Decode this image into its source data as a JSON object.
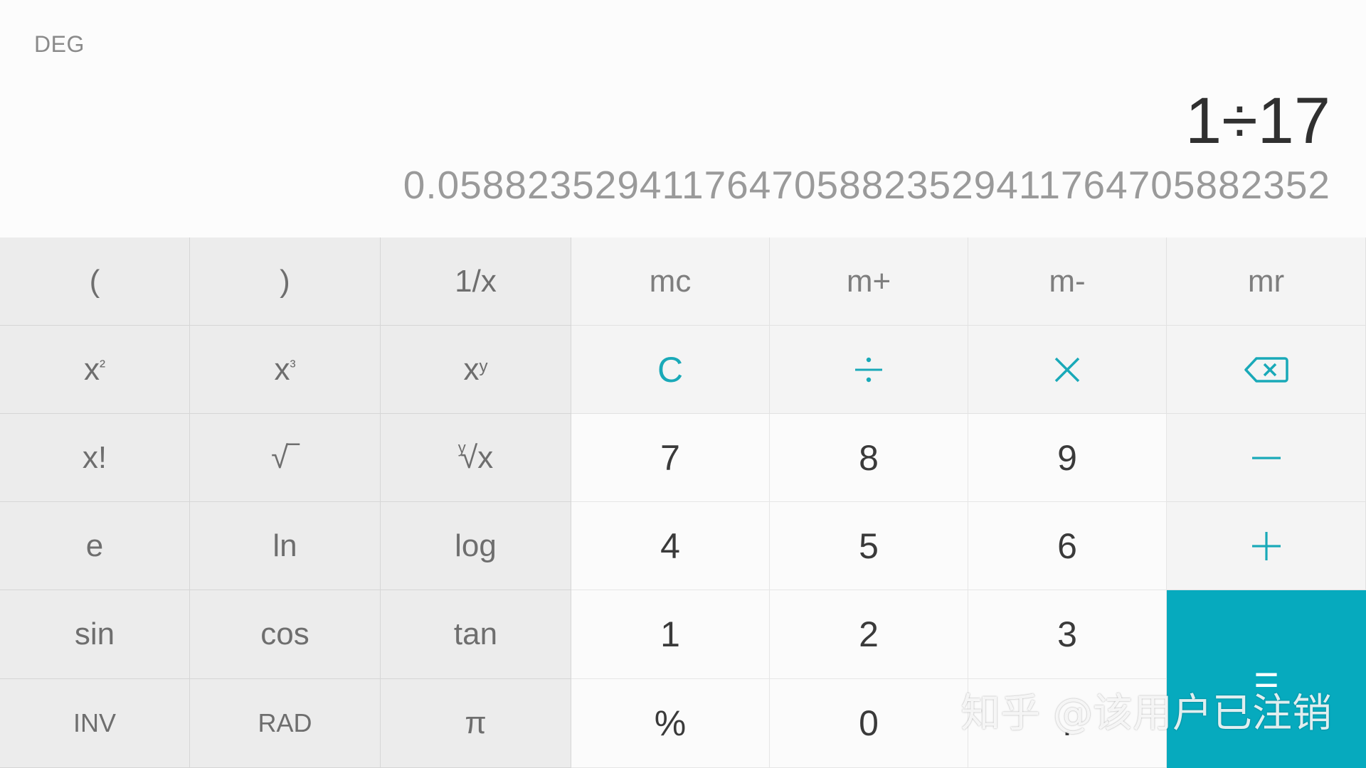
{
  "display": {
    "mode": "DEG",
    "expression": "1÷17",
    "result": "0.05882352941176470588235294117647058823​52"
  },
  "keys": {
    "open_paren": "(",
    "close_paren": ")",
    "reciprocal": "1/x",
    "mc": "mc",
    "m_plus": "m+",
    "m_minus": "m-",
    "mr": "mr",
    "square_base": "x",
    "square_exp": "²",
    "cube_base": "x",
    "cube_exp": "³",
    "power_base": "x",
    "power_exp": "y",
    "clear": "C",
    "factorial": "x!",
    "sqrt": "√‾",
    "nroot_index": "y",
    "nroot_body": "√x",
    "e": "e",
    "ln": "ln",
    "log": "log",
    "sin": "sin",
    "cos": "cos",
    "tan": "tan",
    "inv": "INV",
    "rad": "RAD",
    "pi": "π",
    "percent": "%",
    "dot": ".",
    "digits": {
      "d0": "0",
      "d1": "1",
      "d2": "2",
      "d3": "3",
      "d4": "4",
      "d5": "5",
      "d6": "6",
      "d7": "7",
      "d8": "8",
      "d9": "9"
    },
    "equals": "="
  },
  "icons": {
    "divide": "divide-icon",
    "multiply": "multiply-icon",
    "minus": "minus-icon",
    "plus": "plus-icon",
    "backspace": "backspace-icon"
  },
  "colors": {
    "accent": "#19a9b8",
    "equals_bg": "#06aabe"
  },
  "watermark": "知乎 @该用户已注销"
}
